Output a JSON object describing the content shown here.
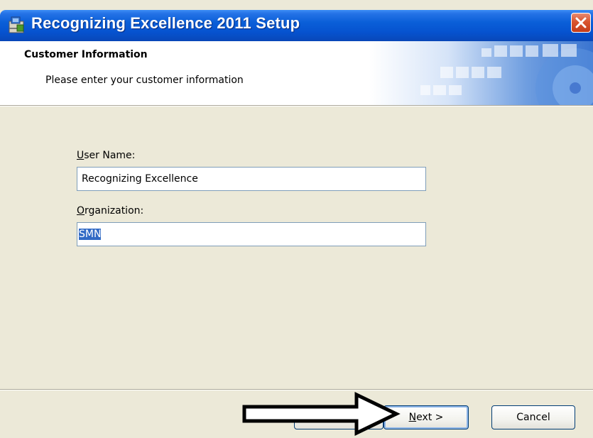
{
  "window": {
    "title": "Recognizing Excellence 2011 Setup"
  },
  "banner": {
    "heading": "Customer Information",
    "subtitle": "Please enter your customer information"
  },
  "form": {
    "user_name_label_underlined": "U",
    "user_name_label_rest": "ser Name:",
    "user_name_value": "Recognizing Excellence",
    "organization_label_underlined": "O",
    "organization_label_rest": "rganization:",
    "organization_value": "SMN"
  },
  "buttons": {
    "next_underlined": "N",
    "next_rest": "ext >",
    "cancel": "Cancel"
  },
  "icons": {
    "title_icon": "installer-icon",
    "close_icon": "close-icon",
    "annotation": "arrow-right-icon"
  },
  "colors": {
    "titlebar": "#0653d0",
    "close_button": "#d9542e",
    "dialog_background": "#ece9d8",
    "selection": "#316ac5"
  }
}
